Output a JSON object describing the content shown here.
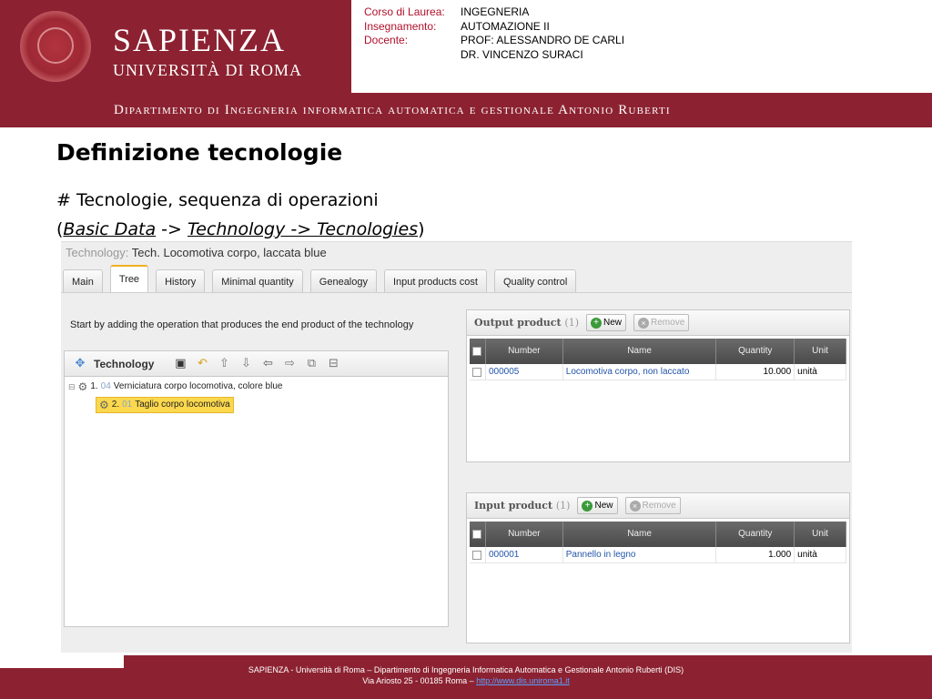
{
  "header": {
    "brand_title": "SAPIENZA",
    "brand_subtitle": "UNIVERSITÀ DI ROMA",
    "course_label": "Corso di Laurea:",
    "course_value": "INGEGNERIA",
    "subject_label": "Insegnamento:",
    "subject_value": "AUTOMAZIONE II",
    "teacher_label": "Docente:",
    "teacher_value_1": "PROF: ALESSANDRO DE CARLI",
    "teacher_value_2": "DR. VINCENZO SURACI",
    "department": "Dipartimento di Ingegneria informatica automatica e gestionale Antonio Ruberti"
  },
  "slide": {
    "title": "Definizione tecnologie",
    "subtitle": "# Tecnologie, sequenza di operazioni",
    "path_open": "(",
    "path_basic": "Basic Data",
    "path_arrow": " -> ",
    "path_tech": "Technology -> Tecnologies",
    "path_close": ")"
  },
  "app": {
    "record_label": "Technology:",
    "record_value": "Tech. Locomotiva corpo, laccata blue",
    "tabs": [
      "Main",
      "Tree",
      "History",
      "Minimal quantity",
      "Genealogy",
      "Input products cost",
      "Quality control"
    ],
    "active_tab": "Tree",
    "hint": "Start by adding the operation that produces the end product of the technology",
    "tree": {
      "title": "Technology",
      "nodes": [
        {
          "index": "1.",
          "code": "04",
          "name": "Verniciatura corpo locomotiva, colore blue"
        },
        {
          "index": "2.",
          "code": "01",
          "name": "Taglio corpo locomotiva"
        }
      ]
    },
    "output": {
      "title": "Output product",
      "count": "(1)",
      "new": "New",
      "remove": "Remove",
      "columns": [
        "Number",
        "Name",
        "Quantity",
        "Unit"
      ],
      "rows": [
        [
          "000005",
          "Locomotiva corpo, non laccato",
          "10.000",
          "unità"
        ]
      ]
    },
    "input": {
      "title": "Input product",
      "count": "(1)",
      "new": "New",
      "remove": "Remove",
      "columns": [
        "Number",
        "Name",
        "Quantity",
        "Unit"
      ],
      "rows": [
        [
          "000001",
          "Pannello in legno",
          "1.000",
          "unità"
        ]
      ]
    }
  },
  "footer": {
    "line1": "SAPIENZA - Università di Roma – Dipartimento di Ingegneria Informatica Automatica e Gestionale Antonio Ruberti (DIS)",
    "line2": "Via Ariosto 25 - 00185 Roma – ",
    "link": "http://www.dis.uniroma1.it"
  },
  "colors": {
    "brand_red": "#8c2231",
    "selection": "#fbd84e",
    "link": "#2255aa"
  }
}
